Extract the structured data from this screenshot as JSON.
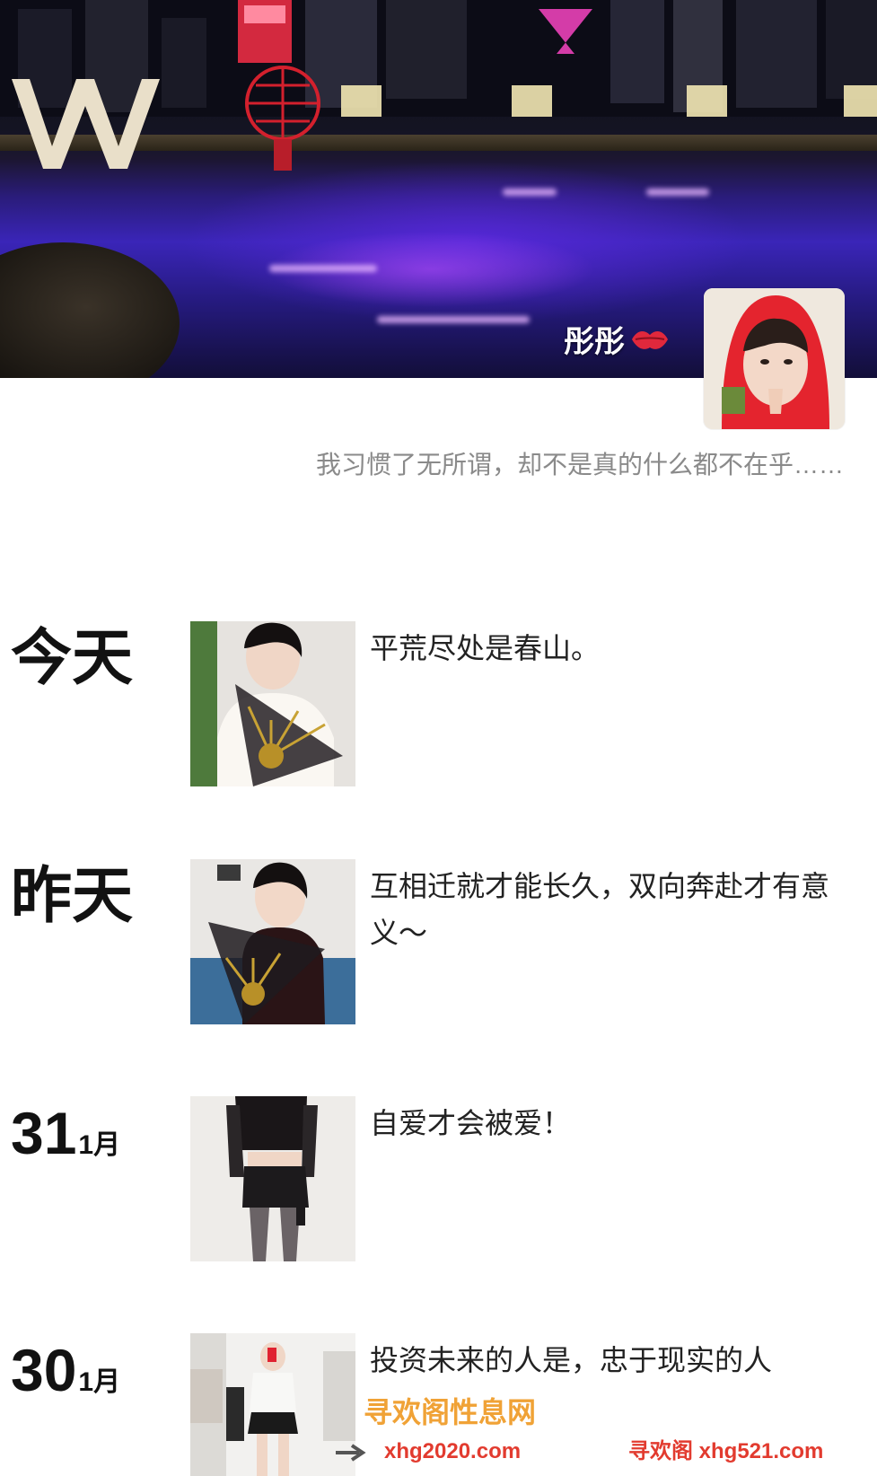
{
  "profile": {
    "name": "彤彤",
    "name_emoji_icon": "kiss-lips-icon",
    "signature": "我习惯了无所谓，却不是真的什么都不在乎……"
  },
  "posts": [
    {
      "date_label": "今天",
      "day": "",
      "month": "",
      "text": "平荒尽处是春山。"
    },
    {
      "date_label": "昨天",
      "day": "",
      "month": "",
      "text": "互相迁就才能长久，双向奔赴才有意义～"
    },
    {
      "date_label": "",
      "day": "31",
      "month": "1月",
      "text": "自爱才会被爱！"
    },
    {
      "date_label": "",
      "day": "30",
      "month": "1月",
      "text": "投资未来的人是，忠于现实的人"
    }
  ],
  "watermark": {
    "site_name": "寻欢阁性息网",
    "url_primary": "xhg2020.com",
    "url_secondary": "寻欢阁 xhg521.com"
  },
  "colors": {
    "watermark_orange": "#f0a236",
    "watermark_red": "#e23b2f",
    "pool_purple": "#3a25b8"
  }
}
